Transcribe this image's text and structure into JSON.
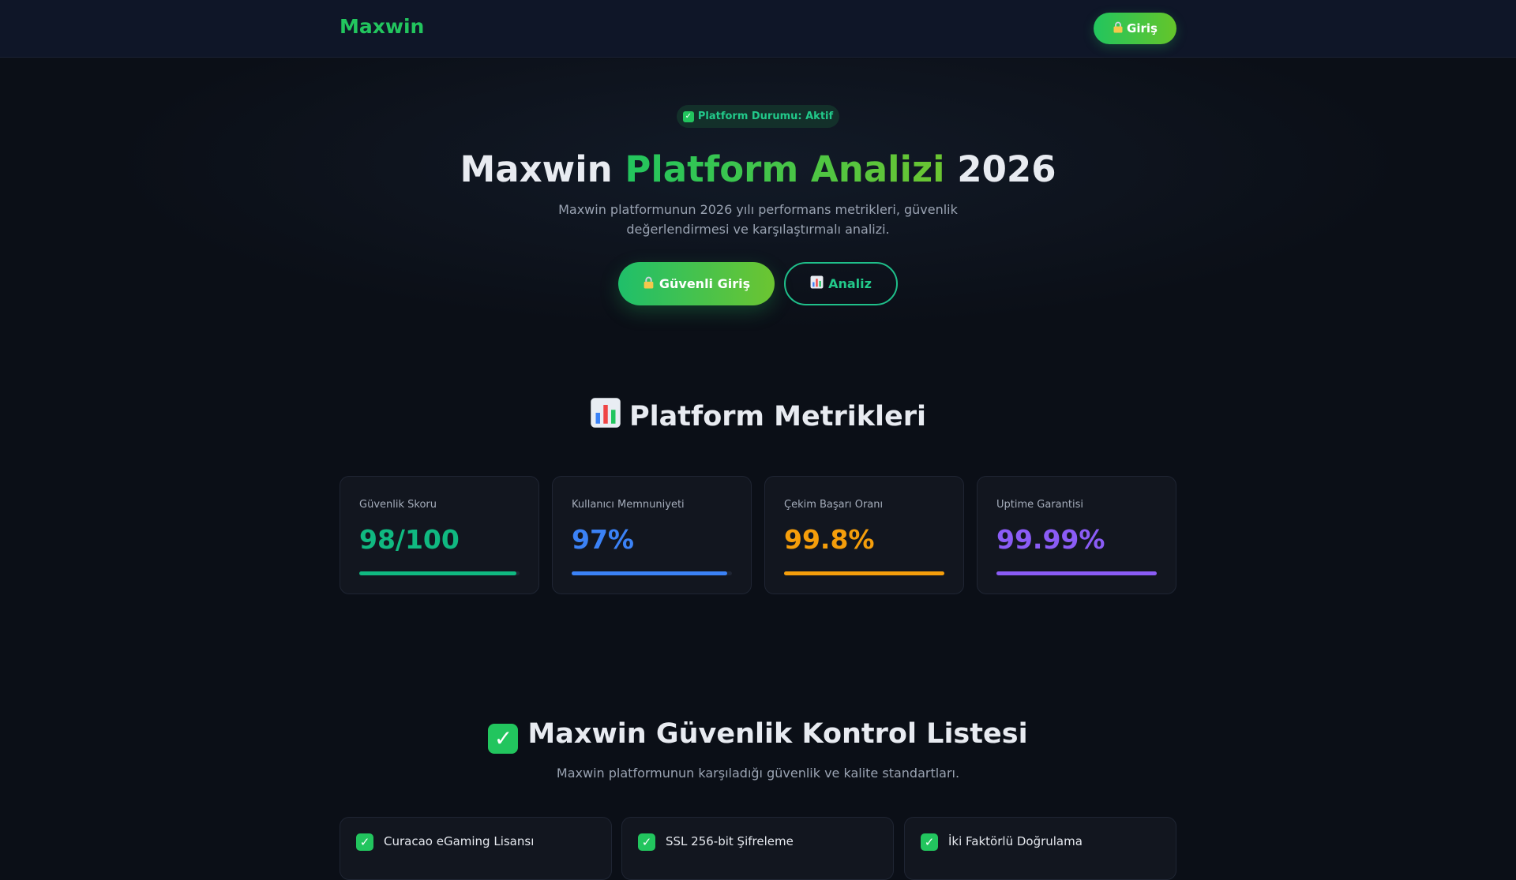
{
  "header": {
    "brand": "Maxwin",
    "login_label": "Giriş",
    "login_icon": "lock-icon"
  },
  "hero": {
    "status_badge": "Platform Durumu: Aktif",
    "title_prefix": "Maxwin",
    "title_accent": "Platform Analizi",
    "title_suffix": "2026",
    "subtitle": "Maxwin platformunun 2026 yılı performans metrikleri, güvenlik değerlendirmesi ve karşılaştırmalı analizi.",
    "primary_button": "Güvenli Giriş",
    "secondary_button": "Analiz"
  },
  "metrics": {
    "title": "Platform Metrikleri",
    "cards": [
      {
        "label": "Güvenlik Skoru",
        "value": "98/100",
        "level": 0.98,
        "color": "#10b981"
      },
      {
        "label": "Kullanıcı Memnuniyeti",
        "value": "97%",
        "level": 0.97,
        "color": "#3b82f6"
      },
      {
        "label": "Çekim Başarı Oranı",
        "value": "99.8%",
        "level": 0.998,
        "color": "#f59e0b"
      },
      {
        "label": "Uptime Garantisi",
        "value": "99.99%",
        "level": 0.9999,
        "color": "#8b5cf6"
      }
    ]
  },
  "checklist": {
    "title": "Maxwin Güvenlik Kontrol Listesi",
    "subtitle": "Maxwin platformunun karşıladığı güvenlik ve kalite standartları.",
    "items": [
      {
        "label": "Curacao eGaming Lisansı"
      },
      {
        "label": "SSL 256-bit Şifreleme"
      },
      {
        "label": "İki Faktörlü Doğrulama"
      }
    ]
  },
  "colors": {
    "accent": "#22c55e",
    "background": "#0b0f17",
    "card": "#12161f"
  }
}
